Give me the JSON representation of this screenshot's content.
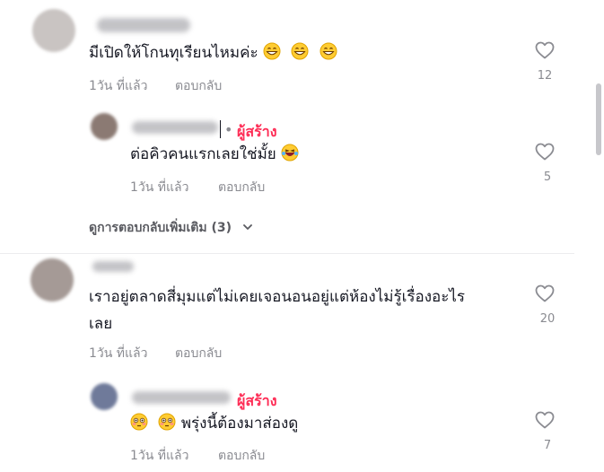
{
  "comments": [
    {
      "text": "มีเปิดให้โกนทุเรียนไหมค่ะ",
      "time": "1วัน ที่แล้ว",
      "reply_label": "ตอบกลับ",
      "likes": "12",
      "emojis": [
        "grinning-face-icon",
        "grinning-face-icon",
        "grinning-face-icon"
      ],
      "replies": [
        {
          "badge": "ผู้สร้าง",
          "text": "ต่อคิวคนแรกเลยใช่มั้ย",
          "time": "1วัน ที่แล้ว",
          "reply_label": "ตอบกลับ",
          "likes": "5",
          "emojis": [
            "laughing-tears-face-icon"
          ]
        }
      ],
      "view_more": "ดูการตอบกลับเพิ่มเติม (3)"
    },
    {
      "text_line1": "เราอยู่ตลาดสี่มุมแต่ไม่เคยเจอนอนอยู่แต่ห้องไม่รู้เรื่องอะไร",
      "text_line2": "เลย",
      "time": "1วัน ที่แล้ว",
      "reply_label": "ตอบกลับ",
      "likes": "20",
      "replies": [
        {
          "badge": "ผู้สร้าง",
          "text": "พรุ่งนี้ต้องมาส่องดู",
          "time": "1วัน ที่แล้ว",
          "reply_label": "ตอบกลับ",
          "likes": "7",
          "emojis": [
            "flushed-face-icon",
            "flushed-face-icon"
          ]
        }
      ]
    }
  ]
}
